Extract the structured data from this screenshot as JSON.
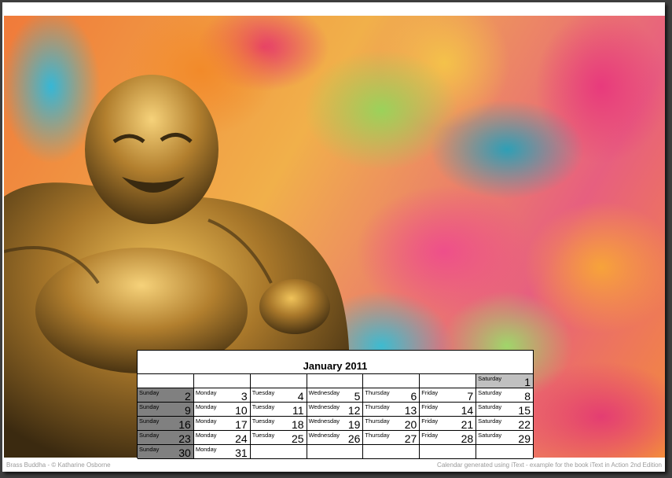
{
  "calendar": {
    "month_title": "January 2011",
    "days": [
      {
        "name": "",
        "num": "",
        "blank": true
      },
      {
        "name": "",
        "num": "",
        "blank": true
      },
      {
        "name": "",
        "num": "",
        "blank": true
      },
      {
        "name": "",
        "num": "",
        "blank": true
      },
      {
        "name": "",
        "num": "",
        "blank": true
      },
      {
        "name": "",
        "num": "",
        "blank": true
      },
      {
        "name": "Saturday",
        "num": "1",
        "highlight": true
      },
      {
        "name": "Sunday",
        "num": "2",
        "sunday": true
      },
      {
        "name": "Monday",
        "num": "3"
      },
      {
        "name": "Tuesday",
        "num": "4"
      },
      {
        "name": "Wednesday",
        "num": "5"
      },
      {
        "name": "Thursday",
        "num": "6"
      },
      {
        "name": "Friday",
        "num": "7"
      },
      {
        "name": "Saturday",
        "num": "8"
      },
      {
        "name": "Sunday",
        "num": "9",
        "sunday": true
      },
      {
        "name": "Monday",
        "num": "10"
      },
      {
        "name": "Tuesday",
        "num": "11"
      },
      {
        "name": "Wednesday",
        "num": "12"
      },
      {
        "name": "Thursday",
        "num": "13"
      },
      {
        "name": "Friday",
        "num": "14"
      },
      {
        "name": "Saturday",
        "num": "15"
      },
      {
        "name": "Sunday",
        "num": "16",
        "sunday": true
      },
      {
        "name": "Monday",
        "num": "17"
      },
      {
        "name": "Tuesday",
        "num": "18"
      },
      {
        "name": "Wednesday",
        "num": "19"
      },
      {
        "name": "Thursday",
        "num": "20"
      },
      {
        "name": "Friday",
        "num": "21"
      },
      {
        "name": "Saturday",
        "num": "22"
      },
      {
        "name": "Sunday",
        "num": "23",
        "sunday": true
      },
      {
        "name": "Monday",
        "num": "24"
      },
      {
        "name": "Tuesday",
        "num": "25"
      },
      {
        "name": "Wednesday",
        "num": "26"
      },
      {
        "name": "Thursday",
        "num": "27"
      },
      {
        "name": "Friday",
        "num": "28"
      },
      {
        "name": "Saturday",
        "num": "29"
      },
      {
        "name": "Sunday",
        "num": "30",
        "sunday": true
      },
      {
        "name": "Monday",
        "num": "31"
      },
      {
        "name": "",
        "num": "",
        "blank": true
      },
      {
        "name": "",
        "num": "",
        "blank": true
      },
      {
        "name": "",
        "num": "",
        "blank": true
      },
      {
        "name": "",
        "num": "",
        "blank": true
      },
      {
        "name": "",
        "num": "",
        "blank": true
      }
    ]
  },
  "footer": {
    "left": "Brass Buddha  - © Katharine Osborne",
    "right": "Calendar generated using iText - example for the book iText in Action 2nd Edition"
  },
  "colors": {
    "sunday_cell": "#808080",
    "highlight_cell": "#c0c0c0",
    "footer_text": "#9a9a9a"
  },
  "icons": {
    "photo": "brass-buddha-photo"
  }
}
